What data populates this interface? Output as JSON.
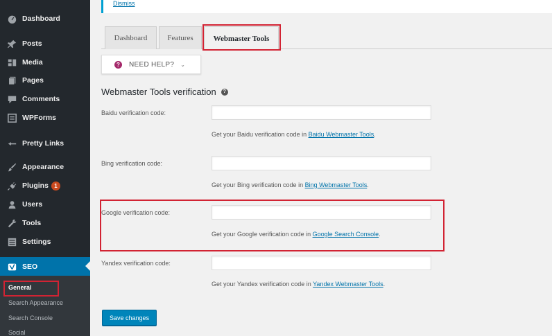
{
  "sidebar": {
    "items": [
      {
        "label": "Dashboard",
        "icon": "dashboard-icon"
      },
      {
        "label": "Posts",
        "icon": "pin-icon"
      },
      {
        "label": "Media",
        "icon": "media-icon"
      },
      {
        "label": "Pages",
        "icon": "pages-icon"
      },
      {
        "label": "Comments",
        "icon": "comments-icon"
      },
      {
        "label": "WPForms",
        "icon": "wpforms-icon"
      },
      {
        "label": "Pretty Links",
        "icon": "pretty-links-icon"
      },
      {
        "label": "Appearance",
        "icon": "appearance-icon"
      },
      {
        "label": "Plugins",
        "icon": "plugins-icon",
        "badge": "1"
      },
      {
        "label": "Users",
        "icon": "users-icon"
      },
      {
        "label": "Tools",
        "icon": "tools-icon"
      },
      {
        "label": "Settings",
        "icon": "settings-icon"
      },
      {
        "label": "SEO",
        "icon": "yoast-seo-icon"
      }
    ],
    "submenu": [
      "General",
      "Search Appearance",
      "Search Console",
      "Social"
    ]
  },
  "notice": {
    "link_text": "Dismiss"
  },
  "tabs": [
    {
      "label": "Dashboard"
    },
    {
      "label": "Features"
    },
    {
      "label": "Webmaster Tools"
    }
  ],
  "help_button": {
    "label": "NEED HELP?",
    "icon": "question-icon",
    "chevron": "chevron-down-icon"
  },
  "section": {
    "title": "Webmaster Tools verification",
    "icon": "info-icon"
  },
  "fields": [
    {
      "label": "Baidu verification code:",
      "value": "",
      "desc_prefix": "Get your Baidu verification code in ",
      "link": "Baidu Webmaster Tools",
      "desc_suffix": "."
    },
    {
      "label": "Bing verification code:",
      "value": "",
      "desc_prefix": "Get your Bing verification code in ",
      "link": "Bing Webmaster Tools",
      "desc_suffix": "."
    },
    {
      "label": "Google verification code:",
      "value": "",
      "desc_prefix": "Get your Google verification code in ",
      "link": "Google Search Console",
      "desc_suffix": "."
    },
    {
      "label": "Yandex verification code:",
      "value": "",
      "desc_prefix": "Get your Yandex verification code in ",
      "link": "Yandex Webmaster Tools",
      "desc_suffix": "."
    }
  ],
  "save_button": {
    "label": "Save changes"
  },
  "colors": {
    "sidebar_bg": "#23282d",
    "accent": "#0073aa",
    "highlight": "#d22333",
    "button": "#0085ba"
  }
}
